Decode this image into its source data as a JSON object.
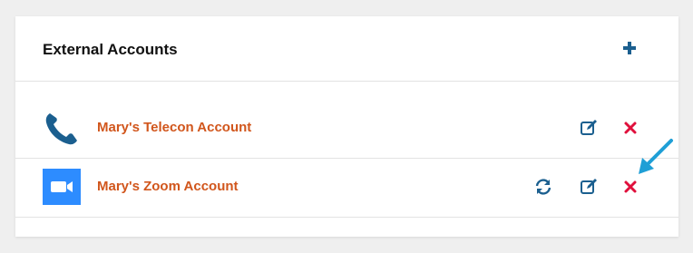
{
  "panel": {
    "title": "External Accounts",
    "icons": {
      "add": "plus-icon"
    }
  },
  "accounts": [
    {
      "name": "Mary's Telecon Account",
      "icon": "phone-icon",
      "actions": [
        "edit-icon",
        "delete-icon"
      ]
    },
    {
      "name": "Mary's Zoom Account",
      "icon": "zoom-camera-icon",
      "actions": [
        "sync-icon",
        "edit-icon",
        "delete-icon"
      ]
    }
  ],
  "colors": {
    "accent": "#1b5f8f",
    "account_name": "#d1561c",
    "delete": "#e0103c",
    "zoom": "#2d8cff",
    "annotation_arrow": "#1f9fd6"
  }
}
